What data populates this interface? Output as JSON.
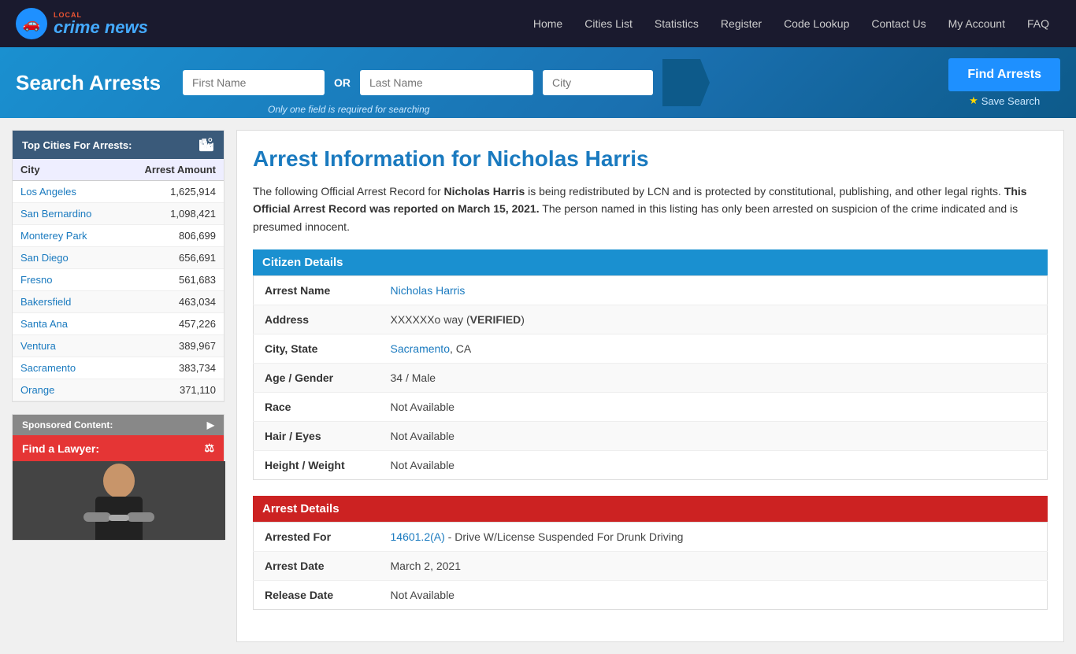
{
  "nav": {
    "logo": {
      "local_label": "LOCAL",
      "name_label": "crime news",
      "icon": "🚗"
    },
    "links": [
      {
        "label": "Home",
        "id": "home"
      },
      {
        "label": "Cities List",
        "id": "cities-list"
      },
      {
        "label": "Statistics",
        "id": "statistics"
      },
      {
        "label": "Register",
        "id": "register"
      },
      {
        "label": "Code Lookup",
        "id": "code-lookup"
      },
      {
        "label": "Contact Us",
        "id": "contact-us"
      },
      {
        "label": "My Account",
        "id": "my-account"
      },
      {
        "label": "FAQ",
        "id": "faq"
      }
    ]
  },
  "search": {
    "title": "Search Arrests",
    "first_name_placeholder": "First Name",
    "last_name_placeholder": "Last Name",
    "city_placeholder": "City",
    "or_label": "OR",
    "hint": "Only one field is required for searching",
    "find_btn": "Find Arrests",
    "save_btn": "Save Search"
  },
  "sidebar": {
    "top_cities_header": "Top Cities For Arrests:",
    "col_city": "City",
    "col_arrests": "Arrest Amount",
    "cities": [
      {
        "name": "Los Angeles",
        "amount": "1,625,914"
      },
      {
        "name": "San Bernardino",
        "amount": "1,098,421"
      },
      {
        "name": "Monterey Park",
        "amount": "806,699"
      },
      {
        "name": "San Diego",
        "amount": "656,691"
      },
      {
        "name": "Fresno",
        "amount": "561,683"
      },
      {
        "name": "Bakersfield",
        "amount": "463,034"
      },
      {
        "name": "Santa Ana",
        "amount": "457,226"
      },
      {
        "name": "Ventura",
        "amount": "389,967"
      },
      {
        "name": "Sacramento",
        "amount": "383,734"
      },
      {
        "name": "Orange",
        "amount": "371,110"
      }
    ],
    "sponsored_header": "Sponsored Content:",
    "find_lawyer_label": "Find a Lawyer:"
  },
  "article": {
    "title": "Arrest Information for Nicholas Harris",
    "intro_part1": "The following Official Arrest Record for ",
    "subject_name": "Nicholas Harris",
    "intro_part2": " is being redistributed by LCN and is protected by constitutional, publishing, and other legal rights. ",
    "bold_statement": "This Official Arrest Record was reported on March 15, 2021.",
    "intro_part3": " The person named in this listing has only been arrested on suspicion of the crime indicated and is presumed innocent.",
    "citizen_details_header": "Citizen Details",
    "arrest_details_header": "Arrest Details",
    "citizen": {
      "arrest_name_label": "Arrest Name",
      "arrest_name_value": "Nicholas Harris",
      "address_label": "Address",
      "address_value": "XXXXXXo way (",
      "address_verified": "VERIFIED",
      "address_close": ")",
      "city_state_label": "City, State",
      "city_value": "Sacramento",
      "state_value": ", CA",
      "age_gender_label": "Age / Gender",
      "age_gender_value": "34 / Male",
      "race_label": "Race",
      "race_value": "Not Available",
      "hair_eyes_label": "Hair / Eyes",
      "hair_eyes_value": "Not Available",
      "height_weight_label": "Height / Weight",
      "height_weight_value": "Not Available"
    },
    "arrest": {
      "arrested_for_label": "Arrested For",
      "arrested_code": "14601.2(A)",
      "arrested_description": " - Drive W/License Suspended For Drunk Driving",
      "arrest_date_label": "Arrest Date",
      "arrest_date_value": "March 2, 2021",
      "release_date_label": "Release Date",
      "release_date_value": "Not Available"
    }
  }
}
